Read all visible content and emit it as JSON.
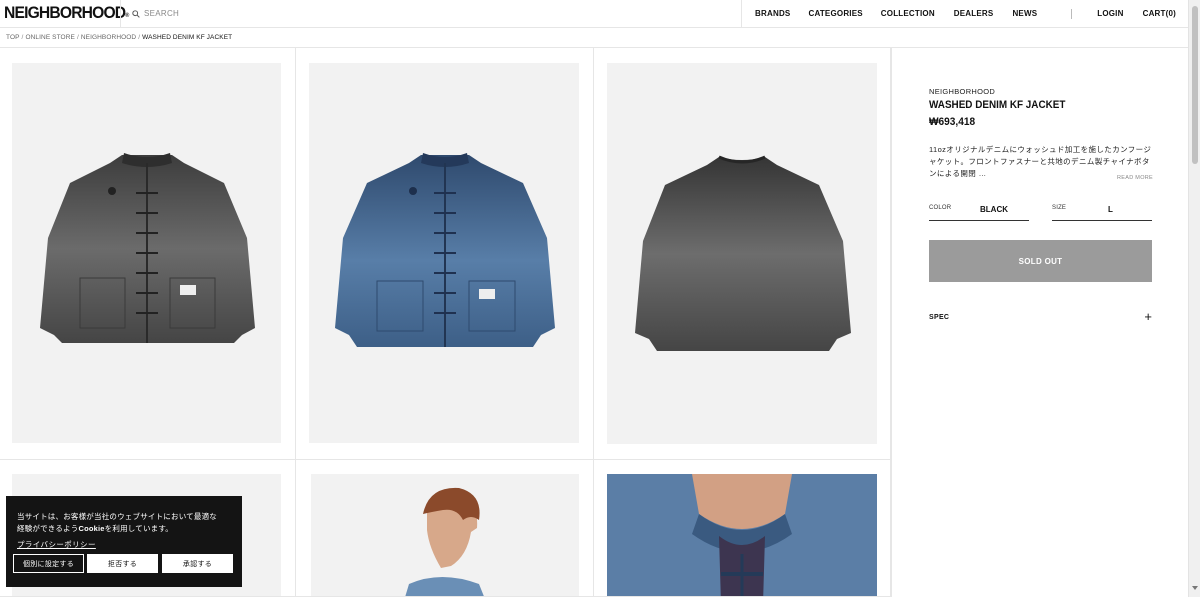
{
  "header": {
    "logo": "NEIGHBORHOOD",
    "logo_mark": "®",
    "search_placeholder": "SEARCH",
    "nav": {
      "brands": "BRANDS",
      "categories": "CATEGORIES",
      "collection": "COLLECTION",
      "dealers": "DEALERS",
      "news": "NEWS",
      "login": "LOGIN",
      "cart": "CART(0)"
    }
  },
  "breadcrumb": {
    "top": "TOP",
    "online_store": "ONLINE STORE",
    "brand": "NEIGHBORHOOD",
    "current": "WASHED DENIM KF JACKET",
    "separator": "/"
  },
  "product": {
    "brand": "NEIGHBORHOOD",
    "title": "WASHED DENIM KF JACKET",
    "price": "₩693,418",
    "description": "11ozオリジナルデニムにウォッシュド加工を施したカンフージャケット。フロントファスナーと共地のデニム製チャイナボタンによる開閉 …",
    "read_more": "READ MORE",
    "color_label": "COLOR",
    "color_value": "BLACK",
    "size_label": "SIZE",
    "size_value": "L",
    "sold_out": "SOLD OUT",
    "spec_label": "SPEC",
    "spec_toggle": "+"
  },
  "images": [
    {
      "name": "black-jacket-front",
      "color": "#4a4a4a"
    },
    {
      "name": "indigo-jacket-front",
      "color": "#3b5a80"
    },
    {
      "name": "black-jacket-back",
      "color": "#4c4c4c"
    },
    {
      "name": "model-front",
      "color": "#6f8db0"
    },
    {
      "name": "model-side",
      "color": "#6f8db0"
    },
    {
      "name": "collar-detail",
      "color": "#5c7fa6"
    }
  ],
  "cookie": {
    "line1": "当サイトは、お客様が当社のウェブサイトにおいて最適な",
    "line2_pre": "経験ができるよう",
    "line2_bold": "Cookie",
    "line2_post": "を利用しています。",
    "policy": "プライバシーポリシー",
    "btn_settings": "個別に設定する",
    "btn_decline": "拒否する",
    "btn_accept": "承認する"
  },
  "colors": {
    "accent": "#111111",
    "sold_out_bg": "#9b9b9b",
    "image_bg": "#f2f2f2",
    "cookie_bg": "#141414"
  }
}
